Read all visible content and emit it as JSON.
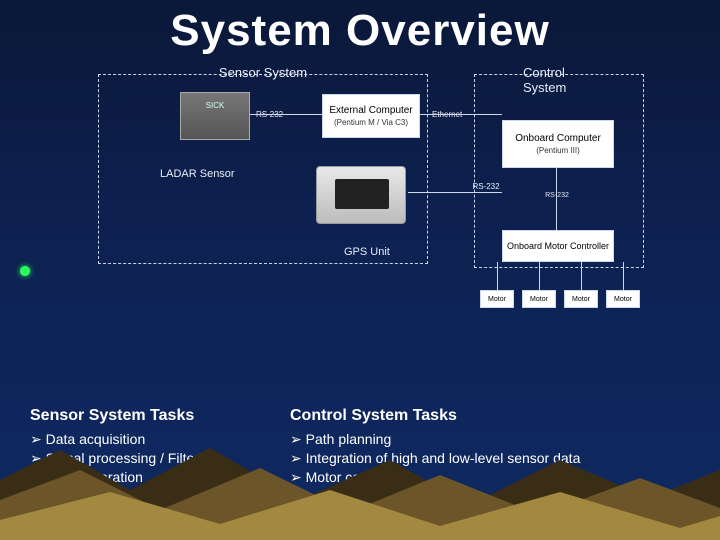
{
  "title": "System Overview",
  "diagram": {
    "sensor_title": "Sensor System",
    "control_title": "Control System",
    "ext_comp": "External Computer",
    "ext_comp_sub": "(Pentium M / Via C3)",
    "onboard": "Onboard Computer",
    "onboard_sub": "(Pentium III)",
    "motor_ctrl": "Onboard Motor Controller",
    "ladar_label": "LADAR Sensor",
    "gps_label": "GPS Unit",
    "rs232": "RS-232",
    "ethernet": "Ethernet",
    "motor": "Motor"
  },
  "tasks": {
    "sensor_heading": "Sensor System Tasks",
    "sensor_items": [
      "Data acquisition",
      "Signal processing / Filtering",
      "Map generation"
    ],
    "control_heading": "Control System Tasks",
    "control_items": [
      "Path planning",
      "Integration of high and low-level sensor data",
      "Motor control"
    ]
  }
}
